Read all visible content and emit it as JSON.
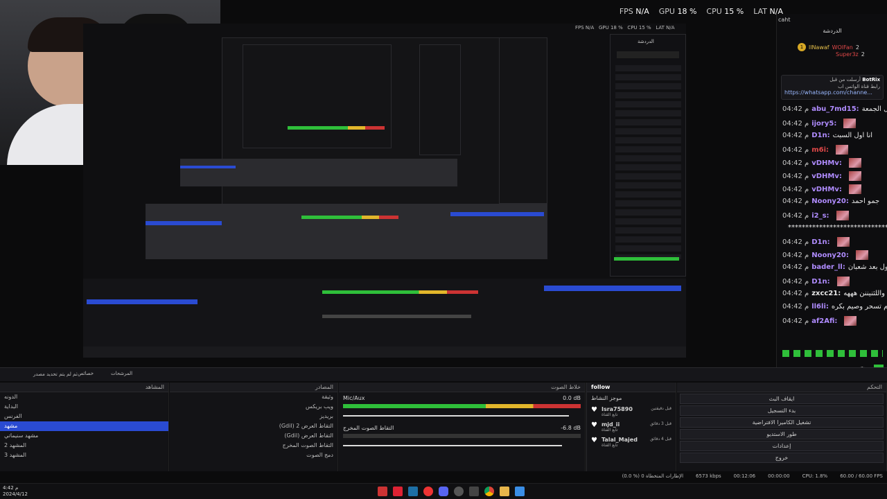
{
  "stats": {
    "fps_label": "FPS",
    "fps_value": "N/A",
    "gpu_label": "GPU",
    "gpu_value": "18 %",
    "cpu_label": "CPU",
    "cpu_value": "15 %",
    "lat_label": "LAT",
    "lat_value": "N/A"
  },
  "chat": {
    "header": "caht",
    "title": "الدردشة",
    "leaderboard": [
      {
        "rank": "1",
        "name": "llNawaf",
        "badge": "WOlFan",
        "count": "2"
      },
      {
        "rank": "",
        "name": "",
        "badge": "Super3z",
        "count": "2"
      }
    ],
    "pinned": {
      "user": "BotRix",
      "intro": "أرسلت من قبل",
      "line": "رابط قناة الواتس اب",
      "link": "https://whatsapp.com/channe..."
    },
    "messages": [
      {
        "time": "04:42 م",
        "user": "abu_7md15:",
        "msg": "انا اول الجمعة",
        "color": "#b08cff"
      },
      {
        "time": "04:42 م",
        "user": "ijory5:",
        "msg": "",
        "color": "#b08cff"
      },
      {
        "time": "04:42 م",
        "user": "D1n:",
        "msg": "انا اول السبت",
        "color": "#b08cff"
      },
      {
        "time": "04:42 م",
        "user": "m6i:",
        "msg": "",
        "color": "#e04848"
      },
      {
        "time": "04:42 م",
        "user": "vDHMv:",
        "msg": "",
        "color": "#b08cff"
      },
      {
        "time": "04:42 م",
        "user": "vDHMv:",
        "msg": "",
        "color": "#b08cff"
      },
      {
        "time": "04:42 م",
        "user": "vDHMv:",
        "msg": "",
        "color": "#b08cff"
      },
      {
        "time": "04:42 م",
        "user": "Noony20:",
        "msg": "جمو احمد",
        "color": "#b08cff"
      },
      {
        "time": "04:42 م",
        "user": "i2_s:",
        "msg": "",
        "color": "#b08cff"
      },
      {
        "time": "",
        "user": "",
        "msg": "**********************************",
        "color": "#e8e8e8"
      },
      {
        "time": "04:42 م",
        "user": "D1n:",
        "msg": "",
        "color": "#b08cff"
      },
      {
        "time": "04:42 م",
        "user": "Noony20:",
        "msg": "",
        "color": "#b08cff"
      },
      {
        "time": "04:42 م",
        "user": "bader_ll:",
        "msg": "انا اول بعد شعبان",
        "color": "#b08cff"
      },
      {
        "time": "04:42 م",
        "user": "D1n:",
        "msg": "",
        "color": "#b08cff"
      },
      {
        "time": "04:42 م",
        "user": "zxcc21:",
        "msg": "واللثنيننن هههه",
        "color": "#e8e8e8"
      },
      {
        "time": "04:42 م",
        "user": "ll6li:",
        "msg": "اليوم تسحر وصيم بكره",
        "color": "#b08cff"
      },
      {
        "time": "04:42 م",
        "user": "af2Afi:",
        "msg": "",
        "color": "#b08cff"
      }
    ]
  },
  "docks": {
    "scenes": {
      "title": "المشاهد",
      "items": [
        "الدونه",
        "البداية",
        "الفرنس",
        "مشهد",
        "مشهد سنيماتي",
        "المشهد 2",
        "المشهد 3"
      ],
      "selected_index": 3
    },
    "sources": {
      "title": "المصادر",
      "items": [
        "وثيقة",
        "ويب بريكس",
        "بريديز",
        "(Gdil) التقاط العرض 2",
        "(Gdil) التقاط العرض",
        "التقاط الصوت المخرج",
        "دمج الصوت"
      ]
    },
    "mixer": {
      "title": "خلاط الصوت",
      "channels": [
        {
          "name": "Mic/Aux",
          "db": "0.0 dB"
        },
        {
          "name": "التقاط الصوت المخرج",
          "db": "-6.8 dB"
        }
      ]
    },
    "follow": {
      "title": "follow",
      "subtitle": "موجز النشاط",
      "rows": [
        {
          "name": "Isra75890",
          "sub": "تابع القناة",
          "when": "قبل دقيقتين"
        },
        {
          "name": "mjd_ii",
          "sub": "تابع القناة",
          "when": "قبل 3 دقائق"
        },
        {
          "name": "Talal_Majed",
          "sub": "تابع القناة",
          "when": "قبل 4 دقائق"
        }
      ]
    },
    "controls": {
      "title": "التحكم",
      "buttons": [
        "ايقاف البث",
        "بدء التسجيل",
        "تشغيل الكاميرا الافتراضية",
        "طور الاستديو",
        "إعدادات",
        "خروج"
      ]
    }
  },
  "dock_bar": {
    "left_label": "ثم لم يتم تحديد مصدر",
    "tab1": "خصائص",
    "tab2": "المرشحات"
  },
  "status": {
    "dropped": "(0.0 %) 0 الإطارات المتخطاة",
    "bitrate": "6573 kbps",
    "time": "00:12:06",
    "rec": "00:00:00",
    "cpu": "CPU: 1.8%",
    "fps": "60.00 / 60.00 FPS"
  },
  "taskbar": {
    "time": "4:42",
    "period": "م",
    "date": "2024/4/12"
  }
}
